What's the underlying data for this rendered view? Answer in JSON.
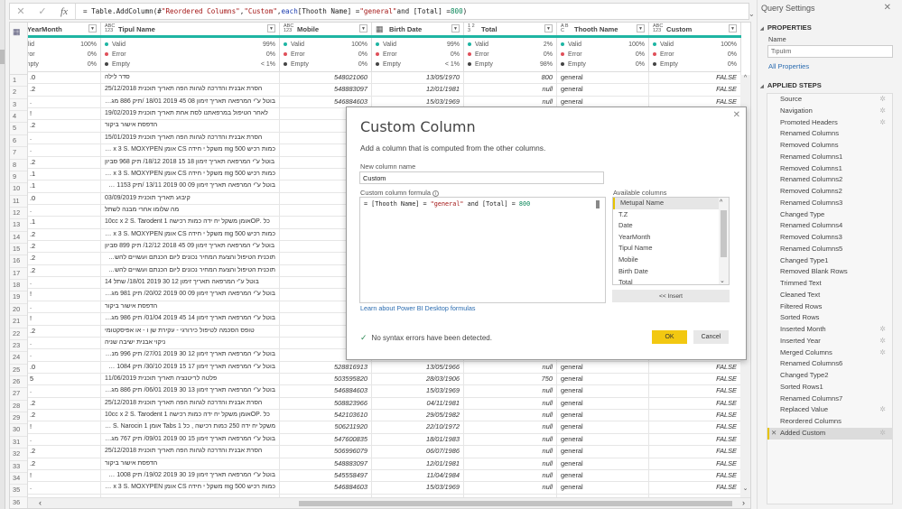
{
  "formula_bar": {
    "cancel_icon": "close-icon",
    "commit_icon": "check-icon",
    "fx_label": "fx",
    "formula_prefix": "= Table.AddColumn(#",
    "formula_str1": "\"Reordered Columns\"",
    "formula_mid1": ", ",
    "formula_str2": "\"Custom\"",
    "formula_mid2": ", ",
    "formula_kw": "each",
    "formula_mid3": " [Thooth Name] = ",
    "formula_str3": "\"general\"",
    "formula_mid4": " and [Total] = ",
    "formula_num": "800",
    "formula_end": ")"
  },
  "table": {
    "columns": [
      {
        "name": "YearMonth",
        "type": "",
        "quality": {
          "valid": "100%",
          "error": "0%",
          "empty": "0%"
        }
      },
      {
        "name": "Tipul Name",
        "type": "ABC 123",
        "quality": {
          "valid": "99%",
          "error": "0%",
          "empty": "< 1%"
        }
      },
      {
        "name": "Mobile",
        "type": "ABC 123",
        "quality": {
          "valid": "100%",
          "error": "0%",
          "empty": "0%"
        }
      },
      {
        "name": "Birth Date",
        "type": "calendar",
        "quality": {
          "valid": "99%",
          "error": "0%",
          "empty": "< 1%"
        }
      },
      {
        "name": "Total",
        "type": "1 2 3",
        "quality": {
          "valid": "2%",
          "error": "0%",
          "empty": "98%"
        }
      },
      {
        "name": "Thooth Name",
        "type": "A B C",
        "quality": {
          "valid": "100%",
          "error": "0%",
          "empty": "0%"
        }
      },
      {
        "name": "Custom",
        "type": "ABC 123",
        "quality": {
          "valid": "100%",
          "error": "0%",
          "empty": "0%"
        }
      }
    ],
    "quality_labels": {
      "valid": "Valid",
      "error": "Error",
      "empty": "Empty"
    },
    "quality_colors": {
      "valid": "#1eb5a3",
      "error": "#e0505a",
      "empty": "#444444"
    },
    "rows": [
      [
        "1",
        ".0",
        "סדר לילה",
        "548021060",
        "13/05/1970",
        "800",
        "general",
        "FALSE"
      ],
      [
        "2",
        ".2",
        "הסרת אבנית והדרכה לגהות הפה תאריך תוכנית 25/12/2018",
        "548883097",
        "12/01/1981",
        "null",
        "general",
        "FALSE"
      ],
      [
        "3",
        ".",
        "בוטל ע\"י המרפאה תאריך זימון 08 45 2019 18/01 /תיק 886 מגדל",
        "546884603",
        "15/03/1969",
        "null",
        "general",
        "FALSE"
      ],
      [
        "4",
        "!",
        "לאחר הטיפול במרפאתנו לסת אחת תאריך תוכנית 19/02/2019",
        "",
        "",
        "",
        "",
        ""
      ],
      [
        "5",
        ".2",
        "הדפסת אישור ביקור",
        "",
        "",
        "",
        "",
        ""
      ],
      [
        "6",
        ".",
        "הסרת אבנית והדרכה לגהות הפה תאריך תוכנית 15/01/2019",
        "",
        "",
        "",
        "",
        ""
      ],
      [
        "7",
        ".",
        "כמות רכיש mg 500 משקל י חידה CS אומן CS 1 x 3 S. MOXYPEN",
        "",
        "",
        "",
        "",
        ""
      ],
      [
        "8",
        ".2",
        "בוטל ע\"י המרפאה תאריך זימון 18 15 2018 18/12/ תיק 968 סביון",
        "",
        "",
        "",
        "",
        ""
      ],
      [
        "9",
        ".1",
        "כמות רכיש mg 500 משקל י חידה CS אומן CS 1 x 3 S. MOXYPEN",
        "",
        "",
        "",
        "",
        ""
      ],
      [
        "10",
        ".1",
        "בוטל ע\"י המרפאה תאריך זימון 09 00 2019 13/11 /תיק 1153 מגדל",
        "",
        "",
        "",
        "",
        ""
      ],
      [
        "11",
        ".0",
        "קיבוע תאריך תוכנית 03/09/2019",
        "",
        "",
        "",
        "",
        ""
      ],
      [
        "12",
        ".",
        "מה שלומו אחרי מבנה לשתל",
        "",
        "",
        "",
        "",
        ""
      ],
      [
        "13",
        ".1",
        "כל .OPאומן משקל יח ידה כמות רכישה 1 10cc x 2 S. Tarodent",
        "",
        "",
        "",
        "",
        ""
      ],
      [
        "14",
        ".2",
        "כמות רכיש mg 500 משקל י חידה CS אומן CS 1 x 3 S. MOXYPEN",
        "",
        "",
        "",
        "",
        ""
      ],
      [
        "15",
        ".2",
        "בוטל ע\"י המרפאה תאריך זימון 09 45 2018 12/12/ תיק 899 סביון",
        "",
        "",
        "",
        "",
        ""
      ],
      [
        "16",
        ".2",
        "תוכנית הטיפול והצעת המחיר נכונים ליום הכנתם ועשויים להשתנות",
        "",
        "",
        "",
        "",
        ""
      ],
      [
        "17",
        ".2",
        "תוכנית הטיפול והצעת המחיר נכונים ליום הכנתם ועשויים להשתנות",
        "",
        "",
        "",
        "",
        ""
      ],
      [
        "18",
        ".",
        "בוטל ע\"י המרפאה תאריך זימון 12 30 2019 18/01/ שתל 14",
        "",
        "",
        "",
        "",
        ""
      ],
      [
        "19",
        "!",
        "בוטל ע\"י המרפאה תאריך זימון 09 00 2019 20/02/ תיק 981 מגדל",
        "",
        "",
        "",
        "",
        ""
      ],
      [
        "20",
        ".",
        "הדפסת אישור ביקור",
        "",
        "",
        "",
        "",
        ""
      ],
      [
        "21",
        "!",
        "בוטל ע\"י המרפאה תאריך זימון 14 45 2019 01/04/ תיק 986 מגדל",
        "",
        "",
        "",
        "",
        ""
      ],
      [
        "22",
        ".2",
        "טופס הסכמה לטיפול כירורגי - עקירת שן ו - או אפיסקטומי",
        "",
        "",
        "",
        "",
        ""
      ],
      [
        "23",
        ".",
        "ניקוי אבנית ישיבה שניה",
        "",
        "",
        "",
        "",
        ""
      ],
      [
        "24",
        ".",
        "בוטל ע\"י המרפאה תאריך זימון 12 30 2019 27/01/ תיק 996 מנורה",
        "",
        "",
        "",
        "",
        ""
      ],
      [
        "25",
        ".0",
        "בוטל ע\"י המרפאה תאריך זימון 17 15 2019 30/10/ תיק 1084 מגד",
        "528816913",
        "13/05/1966",
        "null",
        "general",
        "FALSE"
      ],
      [
        "26",
        "5",
        "פלטה לריטנציה תאריך תוכנית 11/06/2019",
        "503595820",
        "28/03/1906",
        "750",
        "general",
        "FALSE"
      ],
      [
        "27",
        ".",
        "בוטל ע\"י המרפאה תאריך זימון 13 30 2019 06/01/ תיק 886 מגדל",
        "546884603",
        "15/03/1969",
        "null",
        "general",
        "FALSE"
      ],
      [
        "28",
        ".2",
        "הסרת אבנית והדרכה לגהות הפה תאריך תוכנית 25/12/2018",
        "508823966",
        "04/11/1981",
        "null",
        "general",
        "FALSE"
      ],
      [
        "29",
        ".2",
        "כל .OPאומן משקל יח ידה כמות רכישה 1 10cc x 2 S. Tarodent",
        "542103610",
        "29/05/1982",
        "null",
        "general",
        "FALSE"
      ],
      [
        "30",
        "!",
        "משקל יח ידה 250 כמות רכישה , כל 1 Tabs אומן 1 x 2 S. Narocin",
        "506211920",
        "22/10/1972",
        "null",
        "general",
        "FALSE"
      ],
      [
        "31",
        ".",
        "בוטל ע\"י המרפאה תאריך זימון 15 00 2019 09/01/ תיק 767 מגדל",
        "547600835",
        "18/01/1983",
        "null",
        "general",
        "FALSE"
      ],
      [
        "32",
        ".2",
        "הסרת אבנית והדרכה לגהות הפה תאריך תוכנית 25/12/2018",
        "506996079",
        "06/07/1986",
        "null",
        "general",
        "FALSE"
      ],
      [
        "33",
        ".2",
        "הדפסת אישור ביקור",
        "548883097",
        "12/01/1981",
        "null",
        "general",
        "FALSE"
      ],
      [
        "34",
        "!",
        "בוטל ע\"י המרפאה תאריך זימון 19 30 2019 19/02/ תיק 1008 סביון",
        "545558497",
        "11/04/1984",
        "null",
        "general",
        "FALSE"
      ],
      [
        "35",
        ".",
        "כמות רכיש mg 500 משקל י חידה CS אומן CS 1 x 3 S. MOXYPEN",
        "546884603",
        "15/03/1969",
        "null",
        "general",
        "FALSE"
      ],
      [
        "36",
        "",
        "",
        "",
        "",
        "",
        "",
        ""
      ]
    ]
  },
  "dialog": {
    "title": "Custom Column",
    "subtitle": "Add a column that is computed from the other columns.",
    "name_label": "New column name",
    "name_value": "Custom",
    "formula_label": "Custom column formula",
    "formula_a": "= [Thooth Name] = ",
    "formula_str": "\"general\"",
    "formula_b": " and [Total] = ",
    "formula_num": "800",
    "available_label": "Available columns",
    "available_columns": [
      "Metupal Name",
      "T.Z",
      "Date",
      "YearMonth",
      "Tipul Name",
      "Mobile",
      "Birth Date",
      "Total"
    ],
    "insert_label": "<< Insert",
    "learn_link": "Learn about Power BI Desktop formulas",
    "status": "No syntax errors have been detected.",
    "ok_label": "OK",
    "cancel_label": "Cancel",
    "ok_color": "#f2c811"
  },
  "query_settings": {
    "title": "Query Settings",
    "properties_header": "PROPERTIES",
    "name_label": "Name",
    "name_value": "Tipulim",
    "all_properties": "All Properties",
    "steps_header": "APPLIED STEPS",
    "steps": [
      {
        "label": "Source",
        "gear": true
      },
      {
        "label": "Navigation",
        "gear": true
      },
      {
        "label": "Promoted Headers",
        "gear": true
      },
      {
        "label": "Renamed Columns"
      },
      {
        "label": "Removed Columns"
      },
      {
        "label": "Renamed Columns1"
      },
      {
        "label": "Removed Columns1"
      },
      {
        "label": "Renamed Columns2"
      },
      {
        "label": "Removed Columns2"
      },
      {
        "label": "Renamed Columns3"
      },
      {
        "label": "Changed Type"
      },
      {
        "label": "Renamed Columns4"
      },
      {
        "label": "Removed Columns3"
      },
      {
        "label": "Renamed Columns5"
      },
      {
        "label": "Changed Type1"
      },
      {
        "label": "Removed Blank Rows"
      },
      {
        "label": "Trimmed Text"
      },
      {
        "label": "Cleaned Text"
      },
      {
        "label": "Filtered Rows"
      },
      {
        "label": "Sorted Rows"
      },
      {
        "label": "Inserted Month",
        "gear": true
      },
      {
        "label": "Inserted Year",
        "gear": true
      },
      {
        "label": "Merged Columns",
        "gear": true
      },
      {
        "label": "Renamed Columns6"
      },
      {
        "label": "Changed Type2"
      },
      {
        "label": "Sorted Rows1"
      },
      {
        "label": "Renamed Columns7"
      },
      {
        "label": "Replaced Value",
        "gear": true
      },
      {
        "label": "Reordered Columns"
      },
      {
        "label": "Added Custom",
        "gear": true,
        "active": true
      }
    ]
  }
}
